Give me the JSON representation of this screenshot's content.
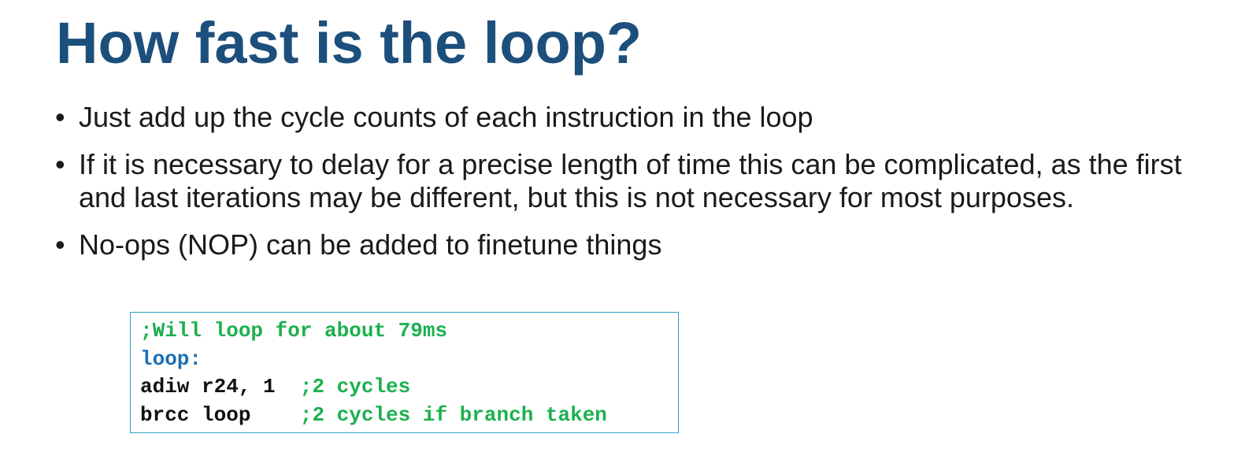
{
  "title": "How fast is the loop?",
  "bullets": [
    {
      "marker": "•",
      "text": "Just add up the cycle counts of each instruction in the loop"
    },
    {
      "marker": "•",
      "text": "If it is necessary to delay for a precise length of time this can be complicated, as the first and last iterations may be different, but this is not necessary for most purposes."
    },
    {
      "marker": "•",
      "text": "No-ops (NOP) can be added to finetune things"
    }
  ],
  "code": {
    "line1_comment": ";Will loop for about 79ms",
    "line2_label": "loop:",
    "line3_instr": "adiw r24, 1  ",
    "line3_comment": ";2 cycles",
    "line4_instr": "brcc loop    ",
    "line4_comment": ";2 cycles if branch taken"
  },
  "colors": {
    "title": "#1c4f7c",
    "body_text": "#1a1a1a",
    "code_comment": "#1cb04e",
    "code_label": "#1a6fb5",
    "code_border": "#2aa3c9"
  }
}
